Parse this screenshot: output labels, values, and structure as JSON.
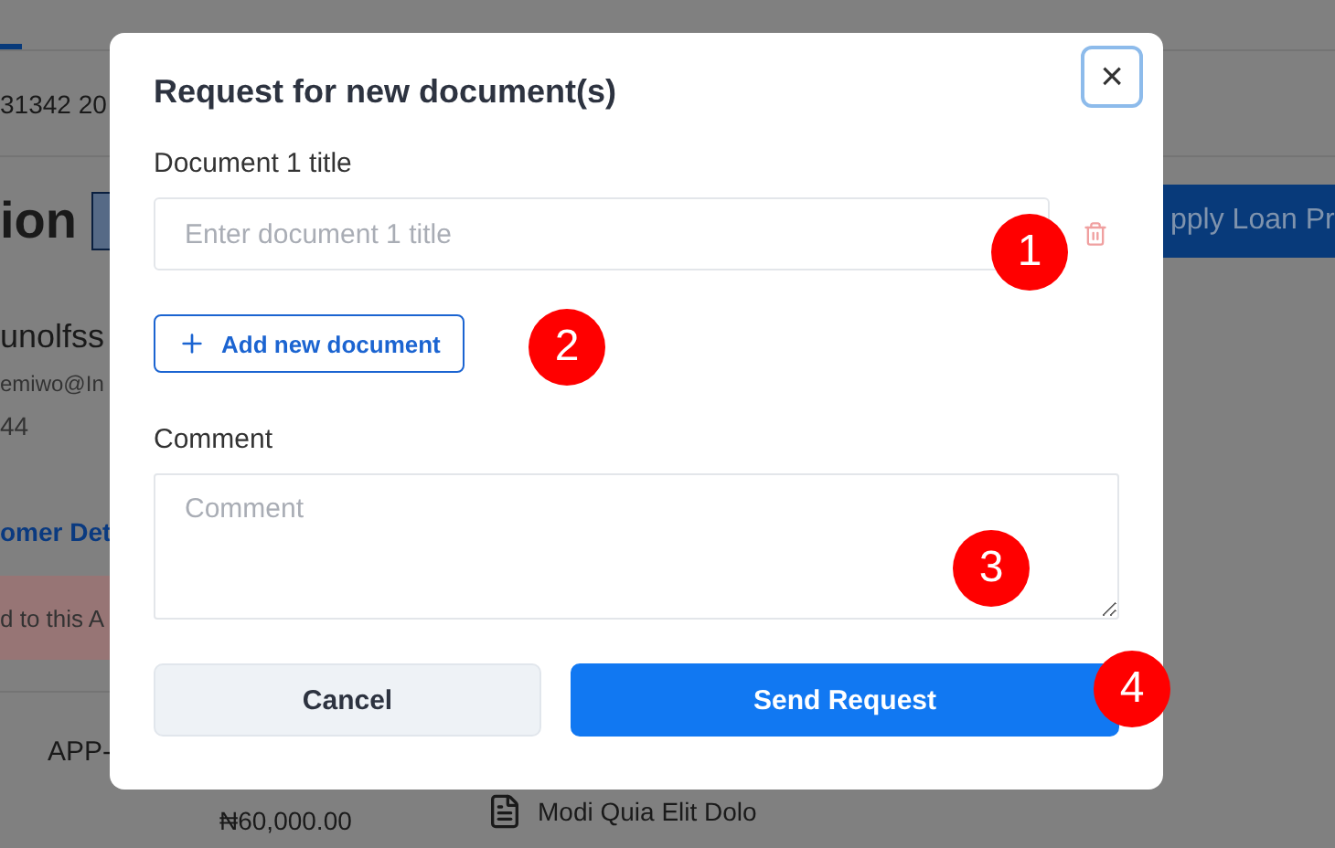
{
  "background": {
    "reference": "31342 20",
    "heading": "ion",
    "apply_button": "pply Loan Pr",
    "customer_name": "unolfss",
    "customer_email": "emiwo@In",
    "customer_phone": "44",
    "customer_link": "omer Det",
    "notice": "d to this A",
    "application_id": "APP-",
    "amount": "₦60,000.00",
    "document": "Modi Quia Elit Dolo"
  },
  "dialog": {
    "title": "Request for new document(s)",
    "close_label": "×",
    "documents": [
      {
        "label": "Document 1 title",
        "placeholder": "Enter document 1 title"
      }
    ],
    "add_button": "Add new document",
    "comment": {
      "label": "Comment",
      "placeholder": "Comment"
    },
    "buttons": [
      {
        "label": "Cancel",
        "kind": "secondary"
      },
      {
        "label": "Send Request",
        "kind": "primary"
      }
    ]
  },
  "annotations": [
    {
      "label": "1"
    },
    {
      "label": "2"
    },
    {
      "label": "3"
    },
    {
      "label": "4"
    }
  ]
}
